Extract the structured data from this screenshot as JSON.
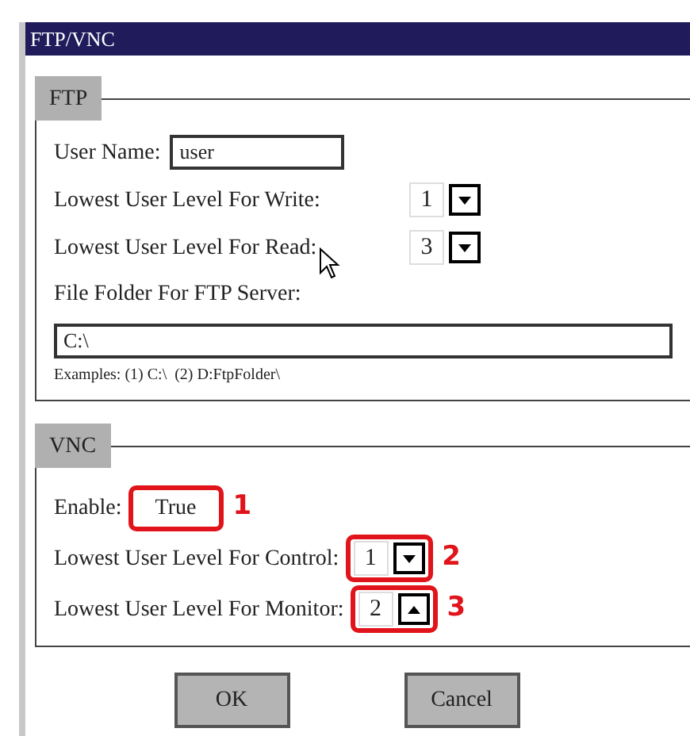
{
  "window": {
    "title": "FTP/VNC"
  },
  "ftp": {
    "title": "FTP",
    "fields": [
      {
        "kind": "text",
        "label": "User Name:",
        "value": "user"
      },
      {
        "kind": "dropdown",
        "label": "Lowest User Level For Write:",
        "value": "1"
      },
      {
        "kind": "dropdown",
        "label": "Lowest User Level For Read:",
        "value": "3"
      }
    ],
    "folder": {
      "label": "File Folder For FTP Server:",
      "value": "C:\\",
      "hint": "Examples: (1) C:\\  (2) D:FtpFolder\\"
    }
  },
  "vnc": {
    "title": "VNC",
    "fields": [
      {
        "kind": "value",
        "label": "Enable:",
        "value": "True",
        "callout": "1"
      },
      {
        "kind": "dropdown",
        "label": "Lowest User Level For Control:",
        "value": "1",
        "callout": "2"
      },
      {
        "kind": "spinner",
        "label": "Lowest User Level For Monitor:",
        "value": "2",
        "callout": "3"
      }
    ]
  },
  "buttons": [
    "OK",
    "Cancel"
  ]
}
